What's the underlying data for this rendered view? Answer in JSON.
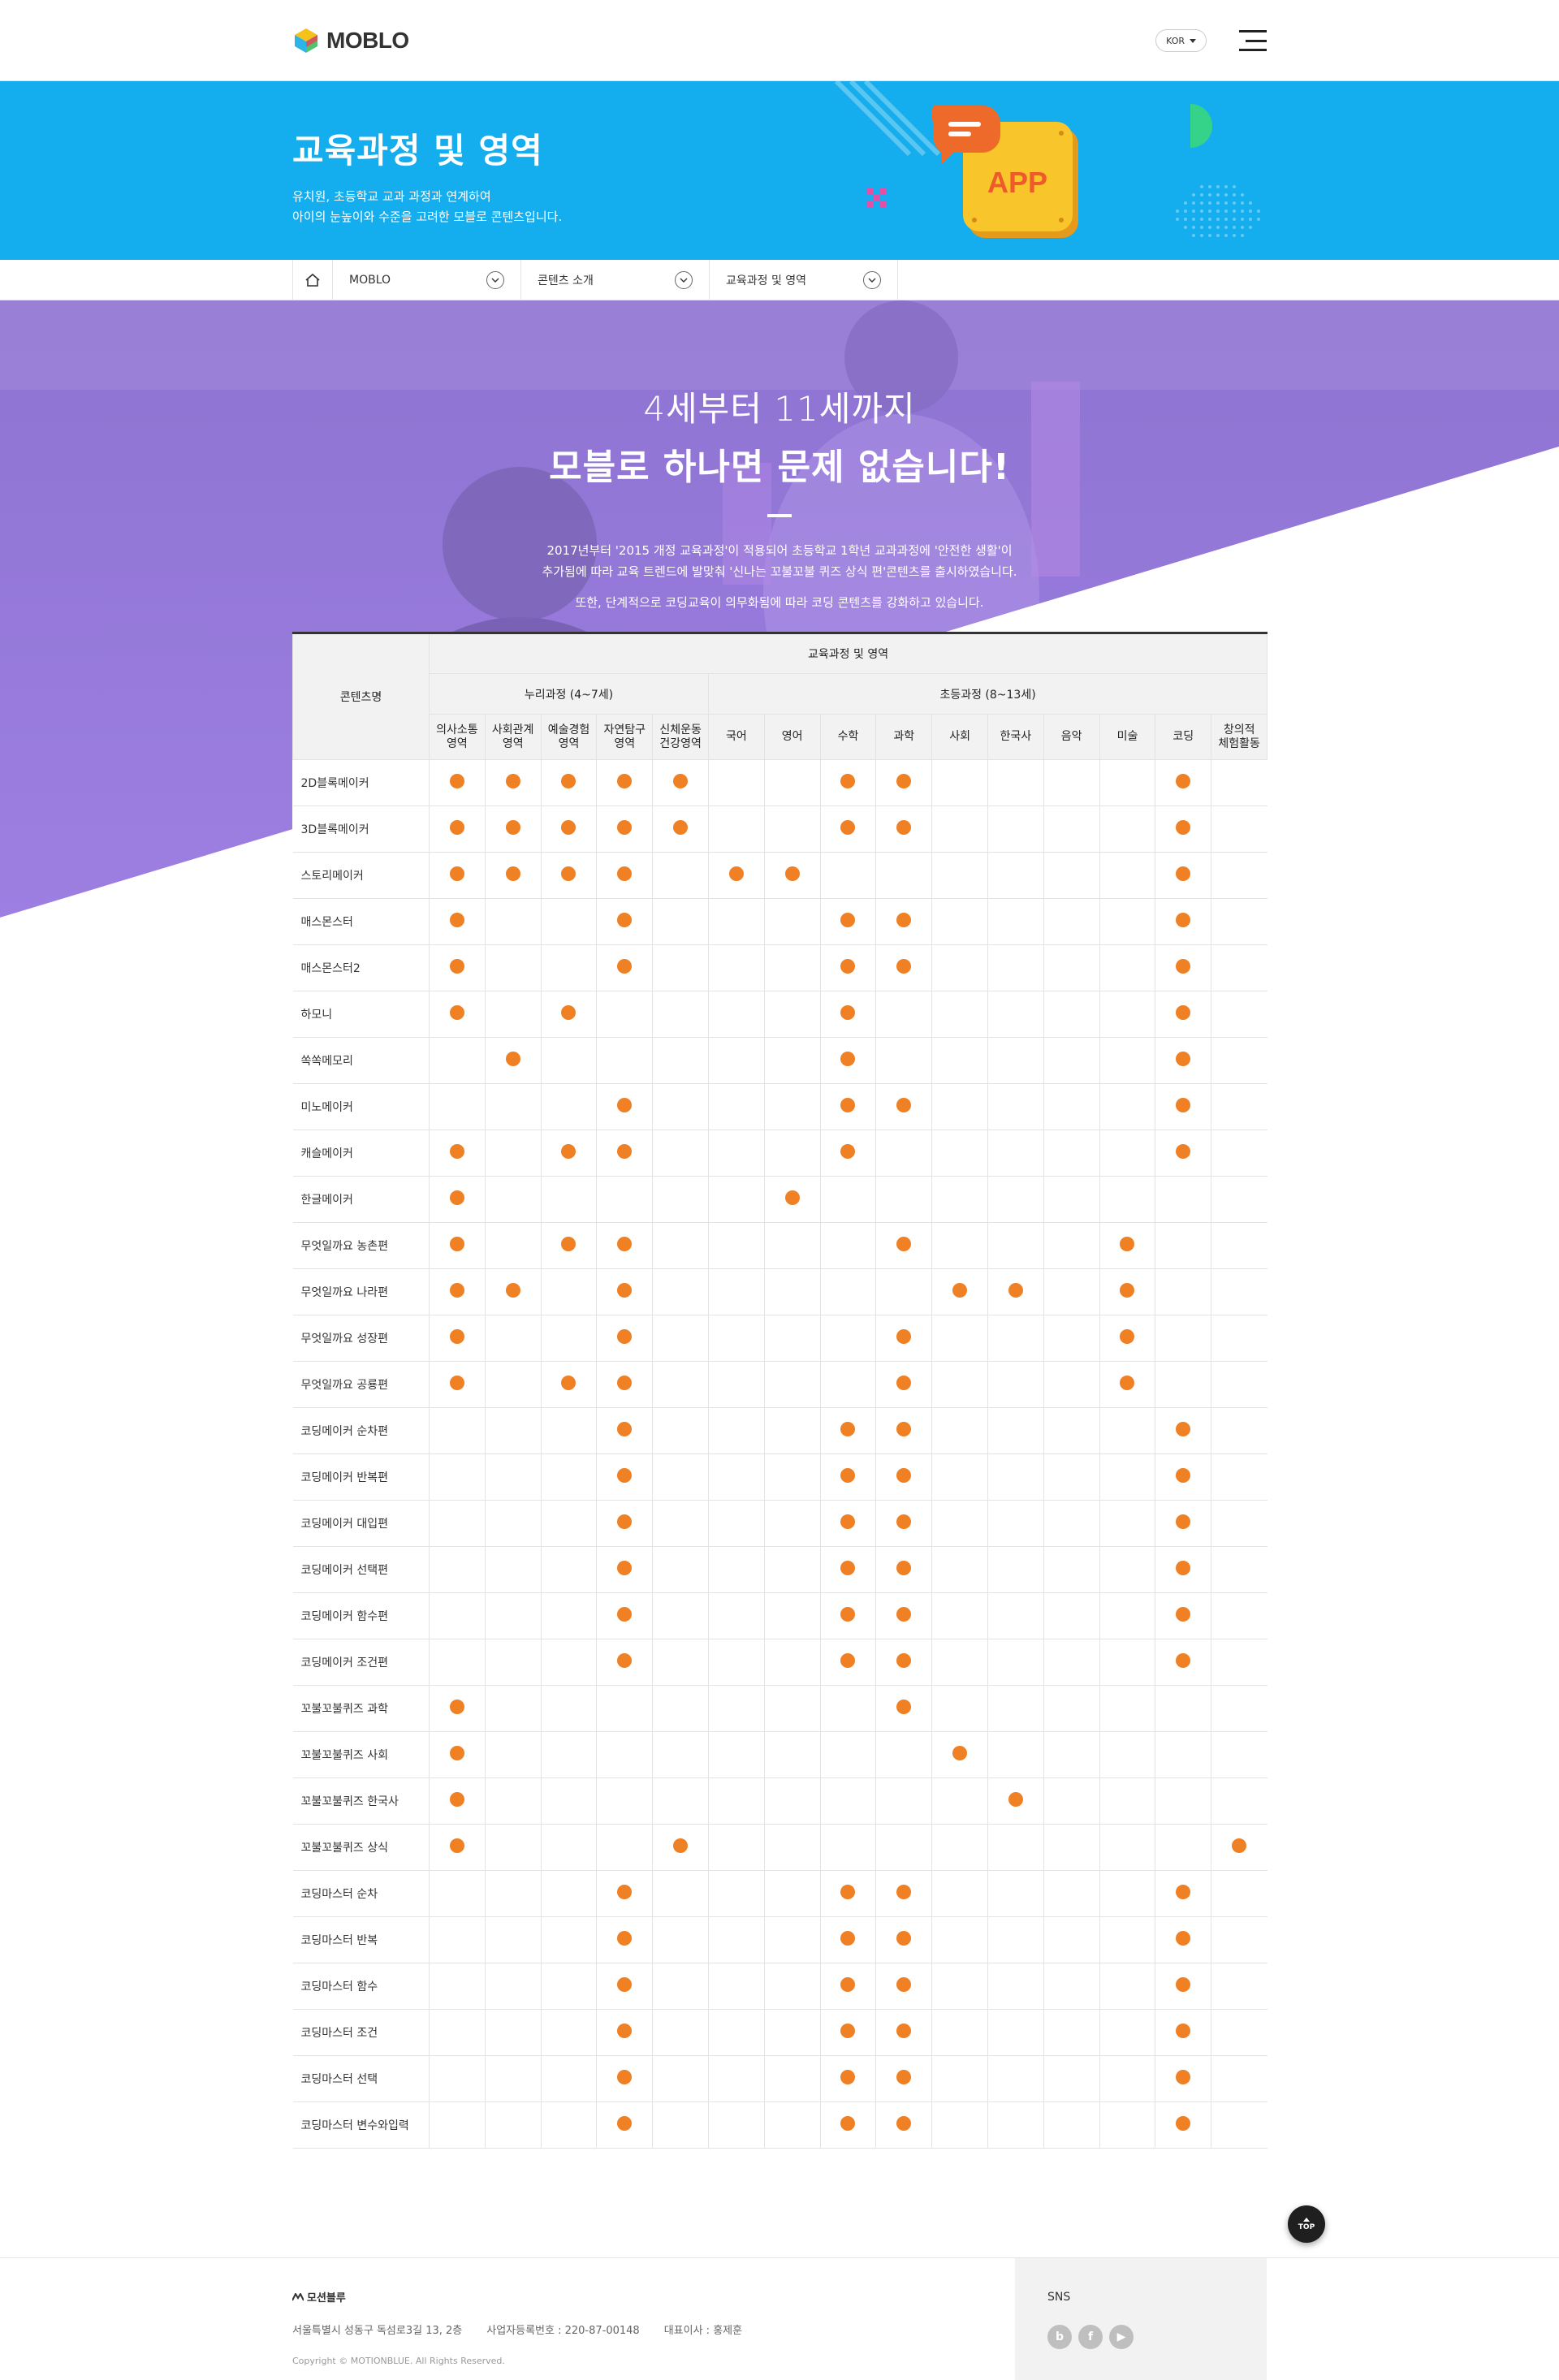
{
  "header": {
    "logo_text": "MOBLO",
    "lang": "KOR"
  },
  "banner": {
    "title": "교육과정 및 영역",
    "desc1": "유치원, 초등학교 교과 과정과 연계하여",
    "desc2": "아이의 눈높이와 수준을 고려한 모블로 콘텐츠입니다.",
    "app_label": "APP"
  },
  "breadcrumb": {
    "items": [
      "MOBLO",
      "콘텐츠 소개",
      "교육과정 및 영역"
    ]
  },
  "hero": {
    "line1": "4세부터 11세까지",
    "line2": "모블로 하나면 문제 없습니다!",
    "p1": "2017년부터 '2015 개정 교육과정'이 적용되어 초등학교 1학년 교과과정에 '안전한 생활'이",
    "p2": "추가됨에 따라 교육 트렌드에 발맞춰 '신나는 꼬불꼬불 퀴즈 상식 편'콘텐츠를 출시하였습니다.",
    "p3": "또한, 단계적으로 코딩교육이 의무화됨에 따라 코딩 콘텐츠를 강화하고 있습니다."
  },
  "table": {
    "col_name_header": "콘텐츠명",
    "group_header": "교육과정 및 영역",
    "nuri_header": "누리과정 (4~7세)",
    "elem_header": "초등과정 (8~13세)",
    "nuri_cols": [
      [
        "의사소통",
        "영역"
      ],
      [
        "사회관계",
        "영역"
      ],
      [
        "예술경험",
        "영역"
      ],
      [
        "자연탐구",
        "영역"
      ],
      [
        "신체운동",
        "건강영역"
      ]
    ],
    "elem_cols": [
      [
        "국어"
      ],
      [
        "영어"
      ],
      [
        "수학"
      ],
      [
        "과학"
      ],
      [
        "사회"
      ],
      [
        "한국사"
      ],
      [
        "음악"
      ],
      [
        "미술"
      ],
      [
        "코딩"
      ],
      [
        "창의적",
        "체험활동"
      ]
    ],
    "rows": [
      {
        "name": "2D블록메이커",
        "marks": [
          1,
          1,
          1,
          1,
          1,
          0,
          0,
          1,
          1,
          0,
          0,
          0,
          0,
          1,
          0
        ]
      },
      {
        "name": "3D블록메이커",
        "marks": [
          1,
          1,
          1,
          1,
          1,
          0,
          0,
          1,
          1,
          0,
          0,
          0,
          0,
          1,
          0
        ]
      },
      {
        "name": "스토리메이커",
        "marks": [
          1,
          1,
          1,
          1,
          0,
          1,
          1,
          0,
          0,
          0,
          0,
          0,
          0,
          1,
          0
        ]
      },
      {
        "name": "매스몬스터",
        "marks": [
          1,
          0,
          0,
          1,
          0,
          0,
          0,
          1,
          1,
          0,
          0,
          0,
          0,
          1,
          0
        ]
      },
      {
        "name": "매스몬스터2",
        "marks": [
          1,
          0,
          0,
          1,
          0,
          0,
          0,
          1,
          1,
          0,
          0,
          0,
          0,
          1,
          0
        ]
      },
      {
        "name": "하모니",
        "marks": [
          1,
          0,
          1,
          0,
          0,
          0,
          0,
          1,
          0,
          0,
          0,
          0,
          0,
          1,
          0
        ]
      },
      {
        "name": "쏙쏙메모리",
        "marks": [
          0,
          1,
          0,
          0,
          0,
          0,
          0,
          1,
          0,
          0,
          0,
          0,
          0,
          1,
          0
        ]
      },
      {
        "name": "미노메이커",
        "marks": [
          0,
          0,
          0,
          1,
          0,
          0,
          0,
          1,
          1,
          0,
          0,
          0,
          0,
          1,
          0
        ]
      },
      {
        "name": "캐슬메이커",
        "marks": [
          1,
          0,
          1,
          1,
          0,
          0,
          0,
          1,
          0,
          0,
          0,
          0,
          0,
          1,
          0
        ]
      },
      {
        "name": "한글메이커",
        "marks": [
          1,
          0,
          0,
          0,
          0,
          0,
          1,
          0,
          0,
          0,
          0,
          0,
          0,
          0,
          0
        ]
      },
      {
        "name": "무엇일까요 농촌편",
        "marks": [
          1,
          0,
          1,
          1,
          0,
          0,
          0,
          0,
          1,
          0,
          0,
          0,
          1,
          0,
          0
        ]
      },
      {
        "name": "무엇일까요 나라편",
        "marks": [
          1,
          1,
          0,
          1,
          0,
          0,
          0,
          0,
          0,
          1,
          1,
          0,
          1,
          0,
          0
        ]
      },
      {
        "name": "무엇일까요 성장편",
        "marks": [
          1,
          0,
          0,
          1,
          0,
          0,
          0,
          0,
          1,
          0,
          0,
          0,
          1,
          0,
          0
        ]
      },
      {
        "name": "무엇일까요 공룡편",
        "marks": [
          1,
          0,
          1,
          1,
          0,
          0,
          0,
          0,
          1,
          0,
          0,
          0,
          1,
          0,
          0
        ]
      },
      {
        "name": "코딩메이커 순차편",
        "marks": [
          0,
          0,
          0,
          1,
          0,
          0,
          0,
          1,
          1,
          0,
          0,
          0,
          0,
          1,
          0
        ]
      },
      {
        "name": "코딩메이커 반복편",
        "marks": [
          0,
          0,
          0,
          1,
          0,
          0,
          0,
          1,
          1,
          0,
          0,
          0,
          0,
          1,
          0
        ]
      },
      {
        "name": "코딩메이커 대입편",
        "marks": [
          0,
          0,
          0,
          1,
          0,
          0,
          0,
          1,
          1,
          0,
          0,
          0,
          0,
          1,
          0
        ]
      },
      {
        "name": "코딩메이커 선택편",
        "marks": [
          0,
          0,
          0,
          1,
          0,
          0,
          0,
          1,
          1,
          0,
          0,
          0,
          0,
          1,
          0
        ]
      },
      {
        "name": "코딩메이커 함수편",
        "marks": [
          0,
          0,
          0,
          1,
          0,
          0,
          0,
          1,
          1,
          0,
          0,
          0,
          0,
          1,
          0
        ]
      },
      {
        "name": "코딩메이커 조건편",
        "marks": [
          0,
          0,
          0,
          1,
          0,
          0,
          0,
          1,
          1,
          0,
          0,
          0,
          0,
          1,
          0
        ]
      },
      {
        "name": "꼬불꼬불퀴즈 과학",
        "marks": [
          1,
          0,
          0,
          0,
          0,
          0,
          0,
          0,
          1,
          0,
          0,
          0,
          0,
          0,
          0
        ]
      },
      {
        "name": "꼬불꼬불퀴즈 사회",
        "marks": [
          1,
          0,
          0,
          0,
          0,
          0,
          0,
          0,
          0,
          1,
          0,
          0,
          0,
          0,
          0
        ]
      },
      {
        "name": "꼬불꼬불퀴즈 한국사",
        "marks": [
          1,
          0,
          0,
          0,
          0,
          0,
          0,
          0,
          0,
          0,
          1,
          0,
          0,
          0,
          0
        ]
      },
      {
        "name": "꼬불꼬불퀴즈 상식",
        "marks": [
          1,
          0,
          0,
          0,
          1,
          0,
          0,
          0,
          0,
          0,
          0,
          0,
          0,
          0,
          1
        ]
      },
      {
        "name": "코딩마스터 순차",
        "marks": [
          0,
          0,
          0,
          1,
          0,
          0,
          0,
          1,
          1,
          0,
          0,
          0,
          0,
          1,
          0
        ]
      },
      {
        "name": "코딩마스터 반복",
        "marks": [
          0,
          0,
          0,
          1,
          0,
          0,
          0,
          1,
          1,
          0,
          0,
          0,
          0,
          1,
          0
        ]
      },
      {
        "name": "코딩마스터 함수",
        "marks": [
          0,
          0,
          0,
          1,
          0,
          0,
          0,
          1,
          1,
          0,
          0,
          0,
          0,
          1,
          0
        ]
      },
      {
        "name": "코딩마스터 조건",
        "marks": [
          0,
          0,
          0,
          1,
          0,
          0,
          0,
          1,
          1,
          0,
          0,
          0,
          0,
          1,
          0
        ]
      },
      {
        "name": "코딩마스터 선택",
        "marks": [
          0,
          0,
          0,
          1,
          0,
          0,
          0,
          1,
          1,
          0,
          0,
          0,
          0,
          1,
          0
        ]
      },
      {
        "name": "코딩마스터 변수와입력",
        "marks": [
          0,
          0,
          0,
          1,
          0,
          0,
          0,
          1,
          1,
          0,
          0,
          0,
          0,
          1,
          0
        ]
      }
    ]
  },
  "top_button": "TOP",
  "footer": {
    "company": "모션블루",
    "address": "서울특별시 성동구 독섬로3길 13, 2층",
    "biz_no": "사업자등록번호 : 220-87-00148",
    "ceo": "대표이사 : 홍제훈",
    "copyright": "Copyright © MOTIONBLUE. All Rights Reserved.",
    "sns_label": "SNS",
    "sns": [
      {
        "icon": "blog-icon",
        "glyph": "b"
      },
      {
        "icon": "facebook-icon",
        "glyph": "f"
      },
      {
        "icon": "youtube-icon",
        "glyph": "▶"
      }
    ]
  },
  "colors": {
    "banner_blue": "#14aeee",
    "hero_purple": "#9a7bdc",
    "dot_orange": "#ef8024"
  }
}
